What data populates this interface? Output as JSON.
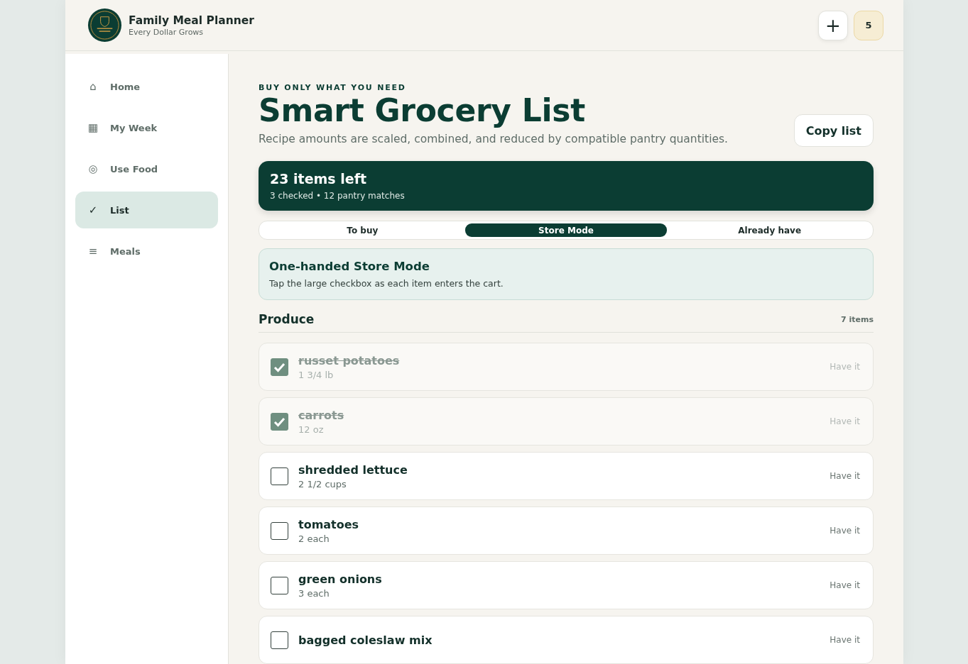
{
  "app": {
    "title": "Family Meal Planner",
    "subtitle": "Every Dollar Grows"
  },
  "header_actions": {
    "add": "+",
    "badge": "5"
  },
  "nav": [
    {
      "icon": "⌂",
      "label": "Home",
      "selected": false
    },
    {
      "icon": "▦",
      "label": "My Week",
      "selected": false
    },
    {
      "icon": "◎",
      "label": "Use Food",
      "selected": false
    },
    {
      "icon": "✓",
      "label": "List",
      "selected": true
    },
    {
      "icon": "≡",
      "label": "Meals",
      "selected": false
    }
  ],
  "page": {
    "eyebrow": "BUY ONLY WHAT YOU NEED",
    "title": "Smart Grocery List",
    "subtitle": "Recipe amounts are scaled, combined, and reduced by compatible pantry quantities.",
    "copy_button": "Copy list"
  },
  "summary": {
    "title": "23 items left",
    "detail": "3 checked • 12 pantry matches"
  },
  "tabs": [
    {
      "label": "To buy",
      "selected": false
    },
    {
      "label": "Store Mode",
      "selected": true
    },
    {
      "label": "Already have",
      "selected": false
    }
  ],
  "notice": {
    "title": "One-handed Store Mode",
    "text": "Tap the large checkbox as each item enters the cart."
  },
  "section": {
    "title": "Produce",
    "count": "7 items"
  },
  "items": [
    {
      "name": "russet potatoes",
      "amount": "1 3/4 lb",
      "checked": true,
      "action": "Have it"
    },
    {
      "name": "carrots",
      "amount": "12 oz",
      "checked": true,
      "action": "Have it"
    },
    {
      "name": "shredded lettuce",
      "amount": "2 1/2 cups",
      "checked": false,
      "action": "Have it"
    },
    {
      "name": "tomatoes",
      "amount": "2 each",
      "checked": false,
      "action": "Have it"
    },
    {
      "name": "green onions",
      "amount": "3 each",
      "checked": false,
      "action": "Have it"
    },
    {
      "name": "bagged coleslaw mix",
      "checked": false,
      "action": "Have it"
    }
  ]
}
